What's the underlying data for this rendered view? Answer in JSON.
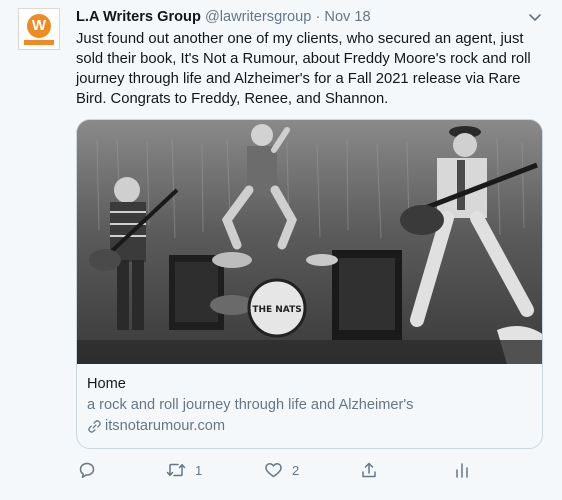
{
  "tweet": {
    "author_name": "L.A Writers Group",
    "handle": "@lawritersgroup",
    "separator": "·",
    "date": "Nov 18",
    "avatar_letter": "W",
    "text": "Just found out another one of my clients, who secured an agent, just sold their book, It's Not a Rumour, about Freddy Moore's rock and roll journey through life and Alzheimer's for a Fall 2021 release via Rare Bird. Congrats to Freddy, Renee, and Shannon."
  },
  "card": {
    "image_drum_text": "THE NATS",
    "title": "Home",
    "description": "a rock and roll journey through life and Alzheimer's",
    "domain": "itsnotarumour.com"
  },
  "actions": {
    "reply_icon": "reply-icon",
    "retweet_count": "1",
    "like_count": "2",
    "share_icon": "share-icon",
    "analytics_icon": "analytics-icon"
  },
  "colors": {
    "background": "#f5f8fa",
    "text_primary": "#14171a",
    "text_secondary": "#657786",
    "border": "#ccd6dd",
    "brand_orange": "#f08a24"
  }
}
